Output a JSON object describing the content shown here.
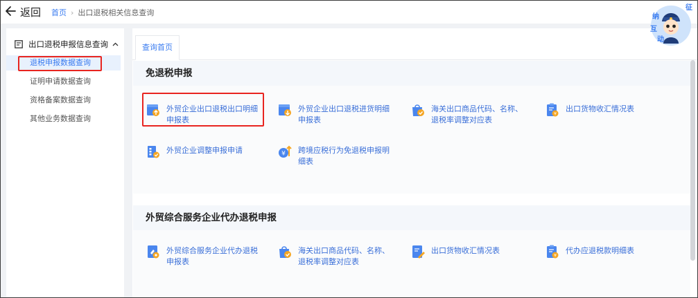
{
  "header": {
    "back_label": "返回",
    "breadcrumb": [
      "首页",
      "出口退税相关信息查询"
    ],
    "mascot_text": [
      "征",
      "纳",
      "互",
      "动"
    ]
  },
  "sidebar": {
    "group_label": "出口退税申报信息查询",
    "items": [
      {
        "label": "退税申报数据查询",
        "active": true
      },
      {
        "label": "证明申请数据查询",
        "active": false
      },
      {
        "label": "资格备案数据查询",
        "active": false
      },
      {
        "label": "其他业务数据查询",
        "active": false
      }
    ]
  },
  "main": {
    "tab_label": "查询首页",
    "sections": [
      {
        "title": "免退税申报",
        "items": [
          {
            "label": "外贸企业出口退税出口明细申报表",
            "icon": "box-up-icon"
          },
          {
            "label": "外贸企业出口退税进货明细申报表",
            "icon": "box-down-icon"
          },
          {
            "label": "海关出口商品代码、名称、退税率调整对应表",
            "icon": "bag-check-icon"
          },
          {
            "label": "出口货物收汇情况表",
            "icon": "clipboard-coin-icon"
          },
          {
            "label": "外贸企业调整申报申请",
            "icon": "building-check-icon"
          },
          {
            "label": "跨境应税行为免退税申报明细表",
            "icon": "coin-arrow-icon"
          }
        ]
      },
      {
        "title": "外贸综合服务企业代办退税申报",
        "items": [
          {
            "label": "外贸综合服务企业代办退税申报表",
            "icon": "doc-gear-icon"
          },
          {
            "label": "海关出口商品代码、名称、退税率调整对应表",
            "icon": "bag-check-icon"
          },
          {
            "label": "出口货物收汇情况表",
            "icon": "doc-edit-icon"
          },
          {
            "label": "代办应退税款明细表",
            "icon": "clipboard-coin-icon"
          }
        ]
      }
    ]
  },
  "colors": {
    "accent": "#3a7cf0",
    "highlight_border": "#e8241f",
    "icon_blue": "#4a86ee",
    "icon_orange": "#f5a623"
  }
}
